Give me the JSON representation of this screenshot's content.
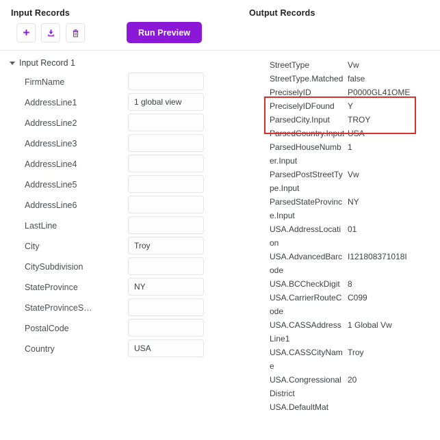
{
  "input_panel": {
    "title": "Input Records",
    "toolbar": [
      {
        "name": "add-record-button",
        "icon": "plus-icon"
      },
      {
        "name": "import-record-button",
        "icon": "download-icon"
      },
      {
        "name": "delete-record-button",
        "icon": "trash-icon"
      }
    ],
    "group": {
      "label": "Input Record 1",
      "expanded": true
    },
    "fields": [
      {
        "label": "FirmName",
        "value": "",
        "placeholder": ""
      },
      {
        "label": "AddressLine1",
        "value": "1 global view",
        "placeholder": ""
      },
      {
        "label": "AddressLine2",
        "value": "",
        "placeholder": ""
      },
      {
        "label": "AddressLine3",
        "value": "",
        "placeholder": ""
      },
      {
        "label": "AddressLine4",
        "value": "",
        "placeholder": ""
      },
      {
        "label": "AddressLine5",
        "value": "",
        "placeholder": ""
      },
      {
        "label": "AddressLine6",
        "value": "",
        "placeholder": ""
      },
      {
        "label": "LastLine",
        "value": "",
        "placeholder": ""
      },
      {
        "label": "City",
        "value": "Troy",
        "placeholder": ""
      },
      {
        "label": "CitySubdivision",
        "value": "",
        "placeholder": ""
      },
      {
        "label": "StateProvince",
        "value": "NY",
        "placeholder": ""
      },
      {
        "label": "StateProvinceS…",
        "value": "",
        "placeholder": ""
      },
      {
        "label": "PostalCode",
        "value": "",
        "placeholder": ""
      },
      {
        "label": "Country",
        "value": "USA",
        "placeholder": ""
      }
    ]
  },
  "actions": {
    "run_preview_label": "Run Preview"
  },
  "output_panel": {
    "title": "Output Records",
    "rows": [
      {
        "key": "StreetType",
        "value": "Vw"
      },
      {
        "key": "StreetType.Matched",
        "value": "false"
      },
      {
        "key": "PreciselyID",
        "value": "P0000GL41OME"
      },
      {
        "key": "PreciselyIDFound",
        "value": "Y"
      },
      {
        "key": "ParsedCity.Input",
        "value": "TROY"
      },
      {
        "key": "ParsedCountry.Input",
        "value": "USA"
      },
      {
        "key": "ParsedHouseNumber.Input",
        "value": "1"
      },
      {
        "key": "ParsedPostStreetType.Input",
        "value": "Vw"
      },
      {
        "key": "ParsedStateProvince.Input",
        "value": "NY"
      },
      {
        "key": "USA.AddressLocation",
        "value": "01"
      },
      {
        "key": "USA.AdvancedBarcode",
        "value": "I121808371018I"
      },
      {
        "key": "USA.BCCheckDigit",
        "value": "8"
      },
      {
        "key": "USA.CarrierRouteCode",
        "value": "C099"
      },
      {
        "key": "USA.CASSAddressLine1",
        "value": "1 Global Vw"
      },
      {
        "key": "USA.CASSCityName",
        "value": "Troy"
      },
      {
        "key": "USA.CongressionalDistrict",
        "value": "20"
      },
      {
        "key": "USA.DefaultMat",
        "value": ""
      }
    ]
  },
  "annotation": {
    "highlight_color": "#d9302b",
    "highlighted_keys": [
      "PreciselyID",
      "PreciselyIDFound"
    ]
  },
  "colors": {
    "accent_purple": "#8A18D6",
    "divider": "#e6e6e8",
    "field_border": "#e4e5e7",
    "text": "#3c4043"
  }
}
